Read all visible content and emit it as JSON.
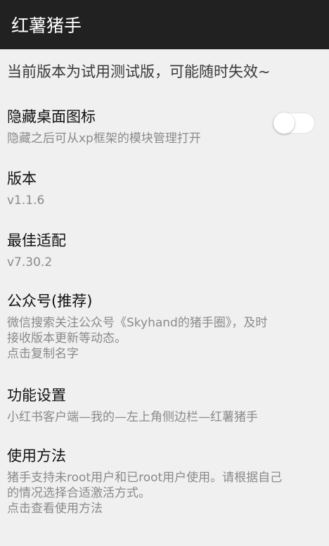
{
  "appbar": {
    "title": "红薯猪手"
  },
  "notice": "当前版本为试用测试版，可能随时失效~",
  "prefs": [
    {
      "title": "隐藏桌面图标",
      "summary": [
        "隐藏之后可从xp框架的模块管理打开"
      ],
      "toggle": false
    },
    {
      "title": "版本",
      "summary": [
        "v1.1.6"
      ]
    },
    {
      "title": "最佳适配",
      "summary": [
        "v7.30.2"
      ]
    },
    {
      "title": "公众号(推荐)",
      "summary": [
        "微信搜索关注公众号《Skyhand的猪手圈》，及时",
        "接收版本更新等动态。",
        "点击复制名字"
      ]
    },
    {
      "title": "功能设置",
      "summary": [
        "小红书客户端—我的—左上角侧边栏—红薯猪手"
      ]
    },
    {
      "title": "使用方法",
      "summary": [
        "猪手支持未root用户和已root用户使用。请根据自己",
        "的情况选择合适激活方式。",
        "点击查看使用方法"
      ]
    }
  ]
}
